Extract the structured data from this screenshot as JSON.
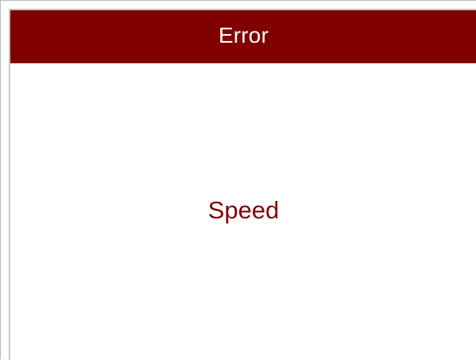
{
  "dialog": {
    "title": "Error",
    "message": "Speed"
  },
  "colors": {
    "header_background": "#800000",
    "header_text": "#ffffff",
    "message_text": "#800000",
    "body_background": "#ffffff",
    "border": "#c8c8c8"
  }
}
